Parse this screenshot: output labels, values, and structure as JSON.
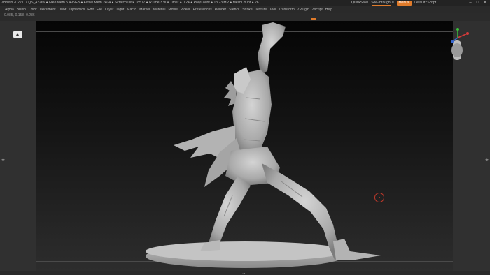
{
  "titlebar": {
    "stats": "ZBrush 2022.0.7    QS_42266    ● Free Mem 5.495GB ● Active Mem 2404 ● Scratch Disk 18517 ● RTime 3.904 Timer ● 0.24 ● PolyCount ● 13.23 MP ● MeshCount ● 26",
    "quicksave": "QuickSave",
    "seethrough": "See-through",
    "seethrough_value": "0",
    "menus": "Menus",
    "default_script": "DefaultZScript"
  },
  "window_controls": {
    "minimize": "–",
    "maximize": "□",
    "close": "✕"
  },
  "menubar": {
    "items": [
      "Alpha",
      "Brush",
      "Color",
      "Document",
      "Draw",
      "Dynamics",
      "Edit",
      "File",
      "Layer",
      "Light",
      "Macro",
      "Marker",
      "Material",
      "Movie",
      "Picker",
      "Preferences",
      "Render",
      "Stencil",
      "Stroke",
      "Texture",
      "Tool",
      "Transform",
      "ZPlugin",
      "Zscript",
      "Help"
    ]
  },
  "shelf": {
    "coords": "0.085,-0.158,-0.236"
  },
  "trays": {
    "left_divider": "◂▸",
    "right_divider": "◂▸"
  },
  "colors": {
    "accent": "#e07b2a",
    "cursor": "#c0392b",
    "gizmo_x": "#d13a3a",
    "gizmo_y": "#3ac13a",
    "gizmo_z": "#3a6ad1"
  },
  "icons": {
    "document": "doc-icon",
    "gizmo": "gizmo-icon",
    "cursor": "draw-cursor-icon"
  }
}
